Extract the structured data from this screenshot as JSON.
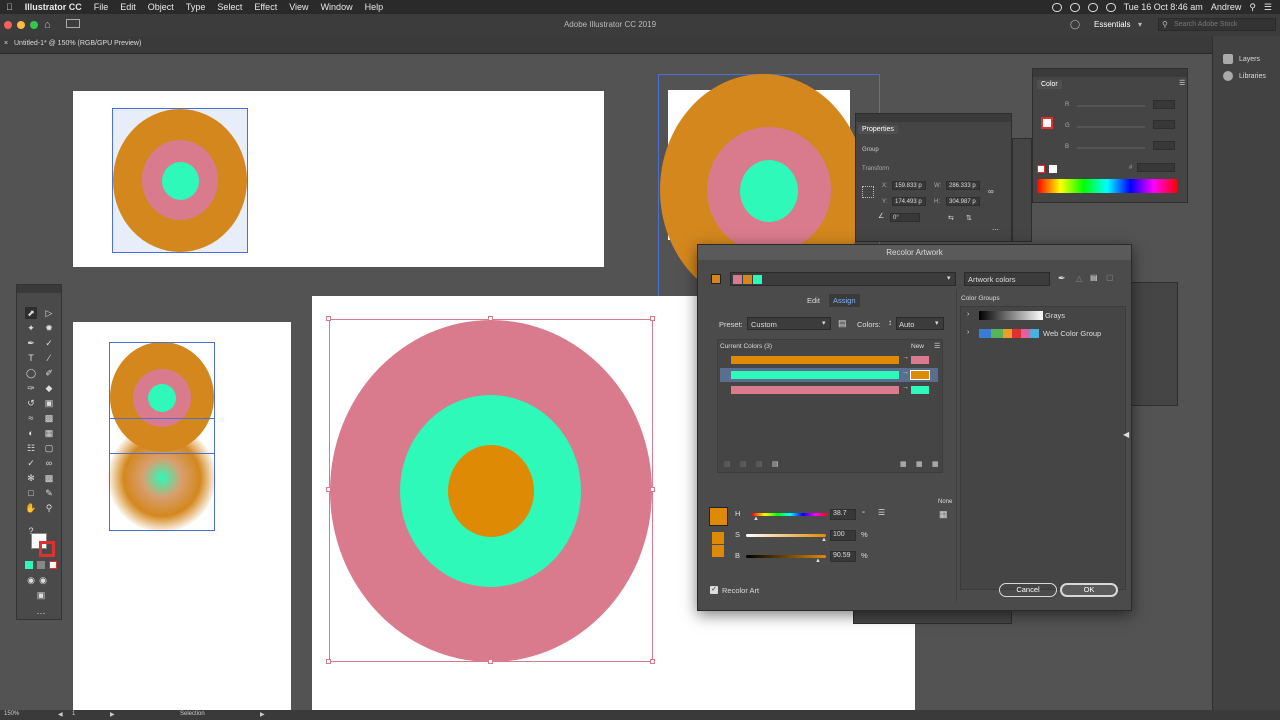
{
  "menubar": {
    "app": "Illustrator CC",
    "items": [
      "File",
      "Edit",
      "Object",
      "Type",
      "Select",
      "Effect",
      "View",
      "Window",
      "Help"
    ],
    "clock": "Tue 16 Oct  8:46 am",
    "user": "Andrew"
  },
  "appbar": {
    "title": "Adobe Illustrator CC 2019",
    "workspace": "Essentials",
    "search_placeholder": "Search Adobe Stock"
  },
  "doc_tab": {
    "label": "Untitled-1* @ 150% (RGB/GPU Preview)"
  },
  "dock": {
    "layers": "Layers",
    "libraries": "Libraries"
  },
  "colors": {
    "orange": "#d4871d",
    "pink": "#d97b8c",
    "teal": "#2ef9b8",
    "selection": "#4d6fcf"
  },
  "color_panel": {
    "title": "Color",
    "r": "R",
    "g": "G",
    "b": "B",
    "hash": "#"
  },
  "properties_panel": {
    "title": "Properties",
    "type": "Group",
    "section": "Transform",
    "x_label": "X:",
    "x": "159.833 p",
    "y_label": "Y:",
    "y": "174.493 p",
    "w_label": "W:",
    "w": "286.333 p",
    "h_label": "H:",
    "h": "304.987 p",
    "angle": "0°"
  },
  "recolor": {
    "title": "Recolor Artwork",
    "artwork_colors": "Artwork colors",
    "tab_edit": "Edit",
    "tab_assign": "Assign",
    "preset_label": "Preset:",
    "preset_value": "Custom",
    "colors_label": "Colors:",
    "colors_value": "Auto",
    "current_colors": "Current Colors (3)",
    "new_label": "New",
    "rows": [
      {
        "current": "#df8a05",
        "new": "#d97b8c"
      },
      {
        "current": "#2ef9b8",
        "new": "#df8a05"
      },
      {
        "current": "#d97b8c",
        "new": "#2ef9b8"
      }
    ],
    "color_groups_label": "Color Groups",
    "groups": [
      "Grays",
      "Web Color Group"
    ],
    "none_label": "None",
    "h_label": "H",
    "h_value": "38.7",
    "h_unit": "°",
    "s_label": "S",
    "s_value": "100",
    "s_unit": "%",
    "b_label": "B",
    "b_value": "90.59",
    "b_unit": "%",
    "recolor_art": "Recolor Art",
    "cancel": "Cancel",
    "ok": "OK"
  },
  "statusbar": {
    "zoom": "150%",
    "artboard": "1",
    "tool": "Selection"
  }
}
